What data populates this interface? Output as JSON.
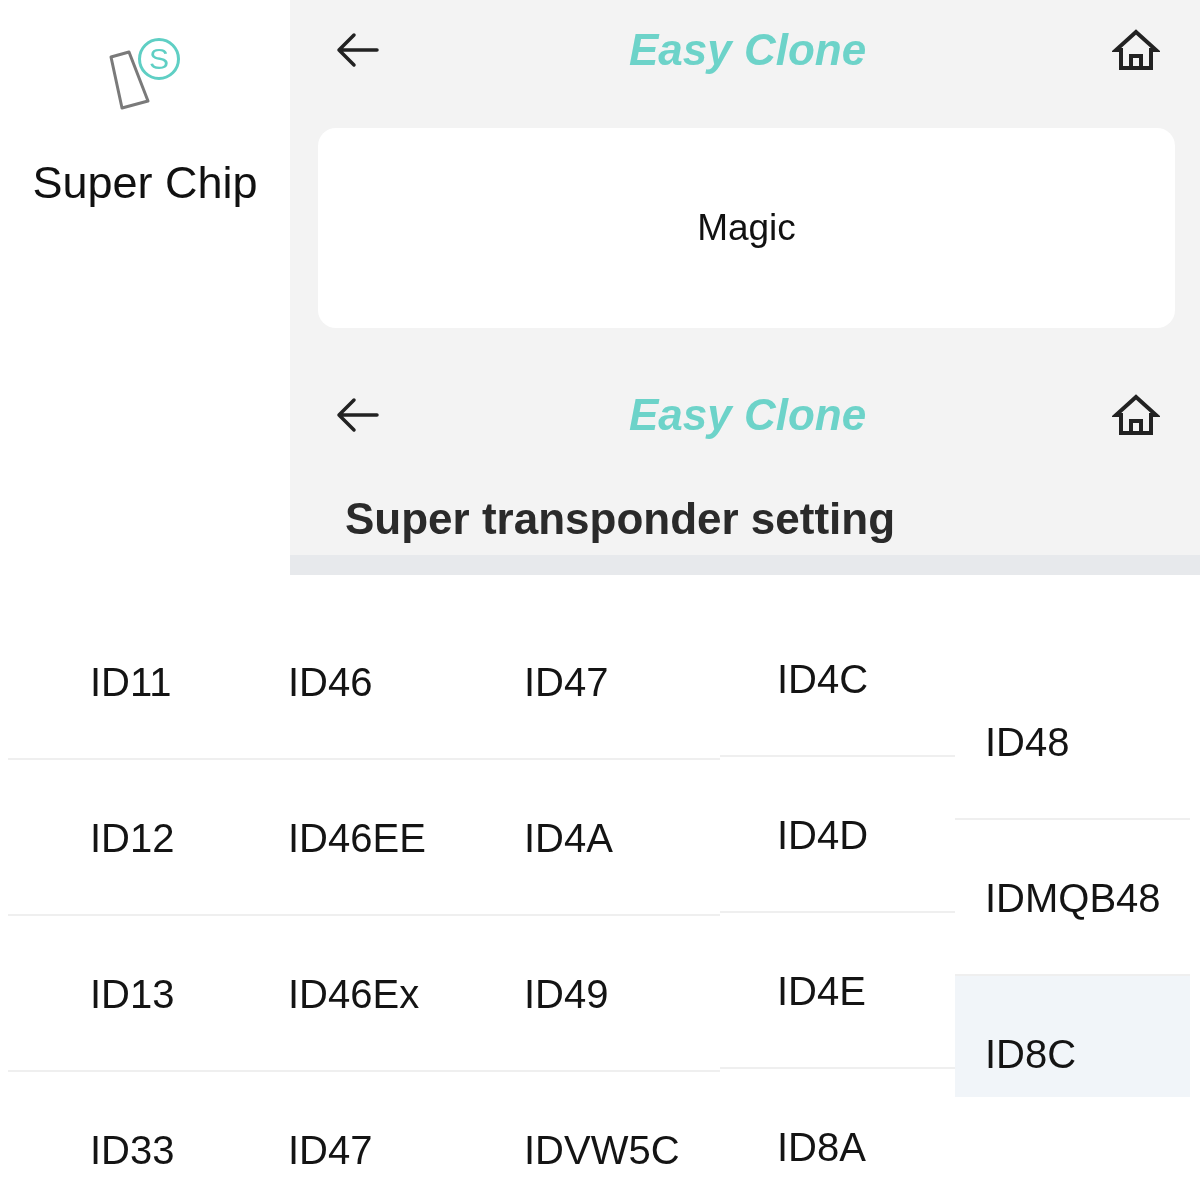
{
  "app_tile": {
    "logo_letter": "S",
    "label": "Super Chip"
  },
  "screens": [
    {
      "header": {
        "title": "Easy Clone"
      },
      "options": [
        {
          "label": "Magic"
        }
      ]
    },
    {
      "header": {
        "title": "Easy Clone"
      },
      "section_title": "Super transponder setting"
    }
  ],
  "transponder_columns": [
    {
      "items": [
        {
          "label": "ID11",
          "selected": false
        },
        {
          "label": "ID12",
          "selected": false
        },
        {
          "label": "ID13",
          "selected": false
        },
        {
          "label": "ID33",
          "selected": false
        }
      ]
    },
    {
      "items": [
        {
          "label": "ID46",
          "selected": false
        },
        {
          "label": "ID46EE",
          "selected": false
        },
        {
          "label": "ID46Ex",
          "selected": false
        },
        {
          "label": "ID47",
          "selected": false
        }
      ]
    },
    {
      "items": [
        {
          "label": "ID47",
          "selected": false
        },
        {
          "label": "ID4A",
          "selected": false
        },
        {
          "label": "ID49",
          "selected": false
        },
        {
          "label": "IDVW5C",
          "selected": false
        }
      ]
    },
    {
      "items": [
        {
          "label": "ID4C",
          "selected": false
        },
        {
          "label": "ID4D",
          "selected": false
        },
        {
          "label": "ID4E",
          "selected": false
        },
        {
          "label": "ID8A",
          "selected": false
        }
      ]
    },
    {
      "items": [
        {
          "label": "ID48",
          "selected": false
        },
        {
          "label": "IDMQB48",
          "selected": false
        },
        {
          "label": "ID8C",
          "selected": true
        }
      ]
    }
  ]
}
